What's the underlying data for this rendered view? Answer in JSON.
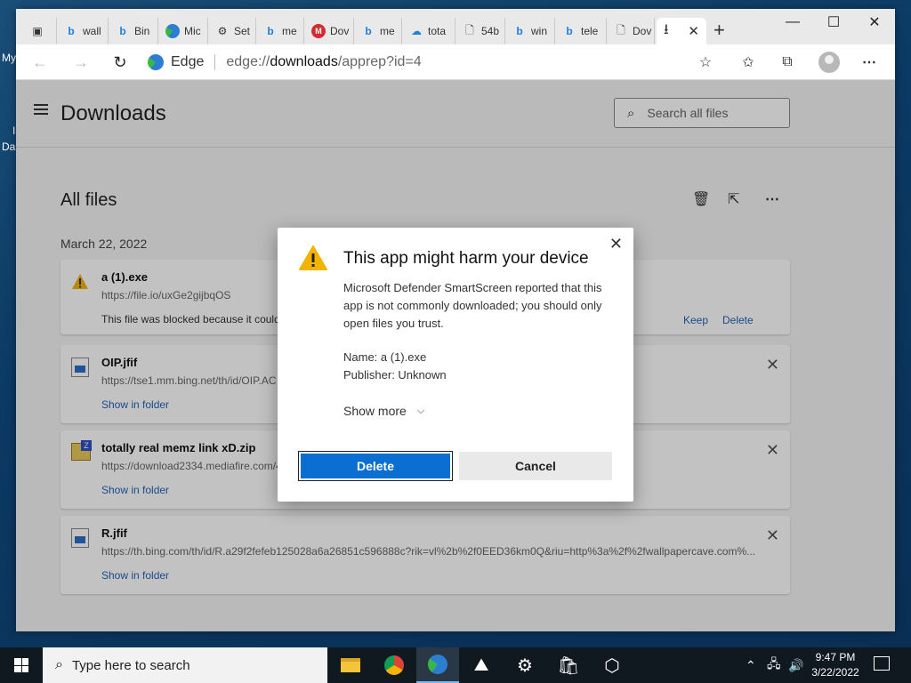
{
  "desktop": {
    "icon_label_1": "My",
    "icon_label_2": "I",
    "icon_label_3": "Da"
  },
  "tabs": [
    {
      "icon": "bing-icon",
      "label": "wall"
    },
    {
      "icon": "bing-icon",
      "label": "Bin"
    },
    {
      "icon": "edge-icon",
      "label": "Mic"
    },
    {
      "icon": "gear-icon",
      "label": "Set"
    },
    {
      "icon": "bing-icon",
      "label": "me"
    },
    {
      "icon": "mega-icon",
      "label": "Dov"
    },
    {
      "icon": "bing-icon",
      "label": "me"
    },
    {
      "icon": "cloud-icon",
      "label": "tota"
    },
    {
      "icon": "doc-icon",
      "label": "54b"
    },
    {
      "icon": "bing-icon",
      "label": "win"
    },
    {
      "icon": "bing-icon",
      "label": "tele"
    },
    {
      "icon": "doc-icon",
      "label": "Dov"
    }
  ],
  "address": {
    "brand": "Edge",
    "url_prefix": "edge://",
    "url_host": "downloads",
    "url_path": "/apprep?id=4"
  },
  "downloads": {
    "title": "Downloads",
    "search_placeholder": "Search all files",
    "section_title": "All files",
    "date": "March 22, 2022",
    "items": [
      {
        "name": "a (1).exe",
        "url": "https://file.io/uxGe2gijbqOS",
        "message": "This file was blocked because it could",
        "keep_label": "Keep",
        "delete_label": "Delete"
      },
      {
        "name": "OIP.jfif",
        "url": "https://tse1.mm.bing.net/th/id/OIP.AC",
        "action": "Show in folder"
      },
      {
        "name": "totally real memz link xD.zip",
        "url": "https://download2334.mediafire.com/4",
        "action": "Show in folder"
      },
      {
        "name": "R.jfif",
        "url": "https://th.bing.com/th/id/R.a29f2fefeb125028a6a26851c596888c?rik=vl%2b%2f0EED36km0Q&riu=http%3a%2f%2fwallpapercave.com%...",
        "action": "Show in folder"
      }
    ]
  },
  "dialog": {
    "title": "This app might harm your device",
    "body": "Microsoft Defender SmartScreen reported that this app is not commonly downloaded; you should only open files you trust.",
    "name_line": "Name: a (1).exe",
    "publisher_line": "Publisher: Unknown",
    "show_more": "Show more",
    "delete_label": "Delete",
    "cancel_label": "Cancel"
  },
  "taskbar": {
    "search_placeholder": "Type here to search",
    "time": "9:47 PM",
    "date": "3/22/2022"
  },
  "colors": {
    "accent": "#0a6fd0",
    "link": "#2464b9",
    "warning": "#f2b400"
  }
}
